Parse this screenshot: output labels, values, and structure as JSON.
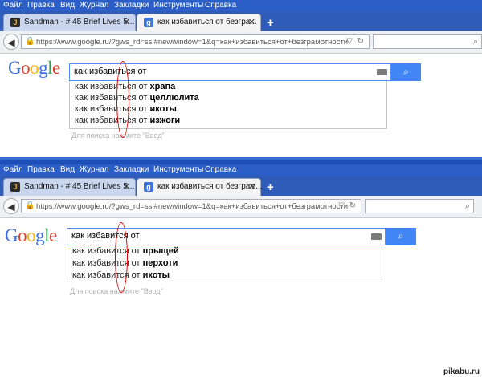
{
  "screenshot_1": {
    "menu": [
      "Файл",
      "Правка",
      "Вид",
      "Журнал",
      "Закладки",
      "Инструменты",
      "Справка"
    ],
    "tabs": [
      {
        "title": "Sandman - # 45 Brief Lives 5...",
        "favicon": "J"
      },
      {
        "title": "как избавиться от безгра...",
        "favicon": "g"
      }
    ],
    "url": "https://www.google.ru/?gws_rd=ssl#newwindow=1&q=как+избавиться+от+безграмотности",
    "search_query": "как избавиться от",
    "suggestions": [
      {
        "prefix": "как избавиться от ",
        "suffix": "храпа"
      },
      {
        "prefix": "как избавиться от ",
        "suffix": "целлюлита"
      },
      {
        "prefix": "как избавиться от ",
        "suffix": "икоты"
      },
      {
        "prefix": "как избавиться от ",
        "suffix": "изжоги"
      }
    ],
    "hint": "Для поиска нажмите \"Ввод\""
  },
  "screenshot_2": {
    "menu": [
      "Файл",
      "Правка",
      "Вид",
      "Журнал",
      "Закладки",
      "Инструменты",
      "Справка"
    ],
    "tabs": [
      {
        "title": "Sandman - # 45 Brief Lives 5...",
        "favicon": "J"
      },
      {
        "title": "как избавиться от безграм...",
        "favicon": "g"
      }
    ],
    "url": "https://www.google.ru/?gws_rd=ssl#newwindow=1&q=как+избавиться+от+безграмотности",
    "search_query": "как избавится от",
    "suggestions": [
      {
        "prefix": "как избавится от ",
        "suffix": "прыщей"
      },
      {
        "prefix": "как избавится от ",
        "suffix": "перхоти"
      },
      {
        "prefix": "как избавится от ",
        "suffix": "икоты"
      }
    ],
    "hint": "Для поиска нажмите \"Ввод\""
  },
  "logo": {
    "letters": [
      "G",
      "o",
      "o",
      "g",
      "l",
      "e"
    ]
  },
  "watermark": "pikabu.ru",
  "colors": {
    "menubar": "#2b5fc7",
    "annotation": "#e00000",
    "google_blue": "#4285f4"
  }
}
